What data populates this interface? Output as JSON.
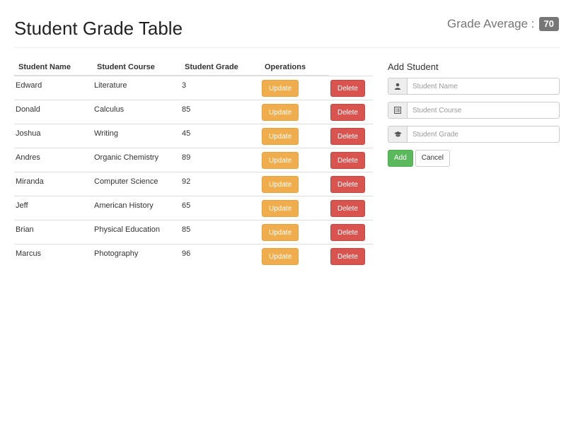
{
  "header": {
    "title": "Student Grade Table",
    "average_label": "Grade Average :",
    "average_value": "70"
  },
  "table": {
    "columns": [
      "Student Name",
      "Student Course",
      "Student Grade",
      "Operations"
    ],
    "update_label": "Update",
    "delete_label": "Delete",
    "rows": [
      {
        "name": "Edward",
        "course": "Literature",
        "grade": "3"
      },
      {
        "name": "Donald",
        "course": "Calculus",
        "grade": "85"
      },
      {
        "name": "Joshua",
        "course": "Writing",
        "grade": "45"
      },
      {
        "name": "Andres",
        "course": "Organic Chemistry",
        "grade": "89"
      },
      {
        "name": "Miranda",
        "course": "Computer Science",
        "grade": "92"
      },
      {
        "name": "Jeff",
        "course": "American History",
        "grade": "65"
      },
      {
        "name": "Brian",
        "course": "Physical Education",
        "grade": "85"
      },
      {
        "name": "Marcus",
        "course": "Photography",
        "grade": "96"
      }
    ]
  },
  "form": {
    "title": "Add Student",
    "fields": [
      {
        "icon": "user-icon",
        "placeholder": "Student Name"
      },
      {
        "icon": "list-alt-icon",
        "placeholder": "Student Course"
      },
      {
        "icon": "graduation-cap-icon",
        "placeholder": "Student Grade"
      }
    ],
    "add_label": "Add",
    "cancel_label": "Cancel"
  },
  "colors": {
    "update": "#f0ad4e",
    "delete": "#d9534f",
    "add": "#5cb85c",
    "badge": "#777777"
  }
}
